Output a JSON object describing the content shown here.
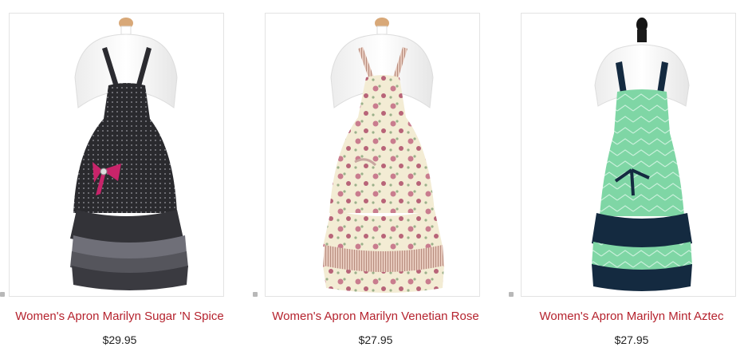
{
  "colors": {
    "link": "#b5232e",
    "price": "#222222",
    "border": "#e3e3e3"
  },
  "products": [
    {
      "name": "Women's Apron Marilyn Sugar 'N Spice",
      "price": "$29.95",
      "image": "black-polka-dot-apron"
    },
    {
      "name": "Women's Apron Marilyn Venetian Rose",
      "price": "$27.95",
      "image": "floral-rose-apron"
    },
    {
      "name": "Women's Apron Marilyn Mint Aztec",
      "price": "$27.95",
      "image": "mint-chevron-apron"
    }
  ]
}
